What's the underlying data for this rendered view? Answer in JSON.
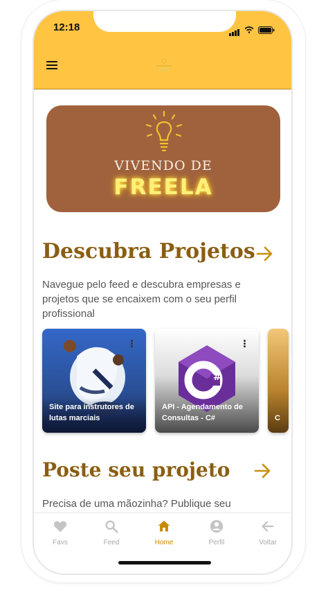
{
  "status": {
    "time": "12:18"
  },
  "banner": {
    "line1": "VIVENDO DE",
    "line2": "FREELA"
  },
  "sections": {
    "discover": {
      "title": "Descubra Projetos",
      "description": "Navegue pelo feed e descubra empresas e projetos que se encaixem com o seu perfil profissional"
    },
    "post": {
      "title": "Poste seu projeto",
      "description": "Precisa de uma mãozinha? Publique seu"
    }
  },
  "projects": [
    {
      "title": "Site para instrutores de lutas marciais",
      "icon": "martial-arts-photo"
    },
    {
      "title": "API - Agendamento de Consultas - C#",
      "icon": "csharp-logo"
    },
    {
      "title": "C",
      "icon": "partial-card"
    }
  ],
  "tabs": [
    {
      "label": "Favs",
      "icon": "heart-icon"
    },
    {
      "label": "Feed",
      "icon": "search-icon"
    },
    {
      "label": "Home",
      "icon": "home-icon"
    },
    {
      "label": "Perfil",
      "icon": "user-icon"
    },
    {
      "label": "Voltar",
      "icon": "back-arrow-icon"
    }
  ],
  "colors": {
    "accent": "#ffc441",
    "title": "#8a5e12",
    "banner": "#a0623c",
    "active_tab": "#c68a00"
  }
}
